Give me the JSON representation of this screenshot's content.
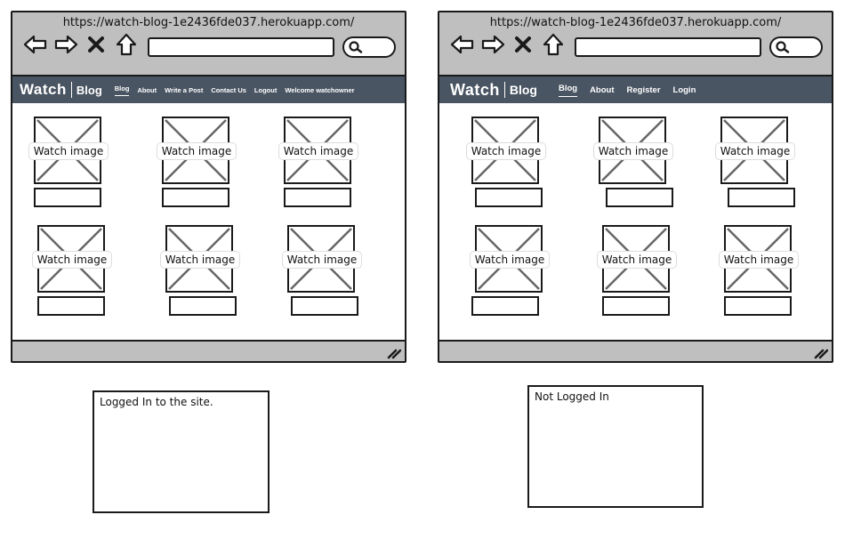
{
  "left_browser": {
    "url": "https://watch-blog-1e2436fde037.herokuapp.com/",
    "brand_main": "Watch",
    "brand_sub": "Blog",
    "nav_links": [
      "Blog",
      "About",
      "Write a Post",
      "Contact Us",
      "Logout",
      "Welcome watchowner"
    ],
    "watch_labels": [
      "Watch image",
      "Watch image",
      "Watch image",
      "Watch image",
      "Watch image",
      "Watch image"
    ]
  },
  "right_browser": {
    "url": "https://watch-blog-1e2436fde037.herokuapp.com/",
    "brand_main": "Watch",
    "brand_sub": "Blog",
    "nav_links": [
      "Blog",
      "About",
      "Register",
      "Login"
    ],
    "watch_labels": [
      "Watch image",
      "Watch image",
      "Watch image",
      "Watch image",
      "Watch image",
      "Watch image"
    ]
  },
  "notes": {
    "left": "Logged In to the site.",
    "right": "Not Logged In"
  },
  "icons": [
    "back-arrow-icon",
    "forward-arrow-icon",
    "close-x-icon",
    "home-icon",
    "search-icon",
    "resize-grip-icon"
  ],
  "colors": {
    "navbar": "#4a5563",
    "chrome": "#bfbfbf"
  }
}
